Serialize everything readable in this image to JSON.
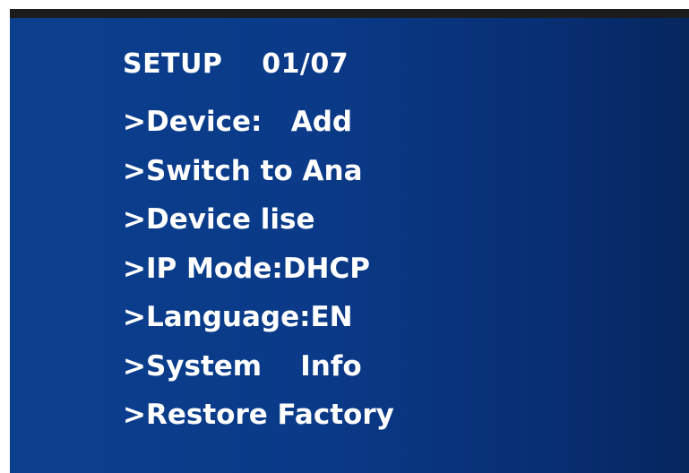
{
  "menu": {
    "title": "SETUP    01/07",
    "items": [
      {
        "label": ">Device:   Add"
      },
      {
        "label": ">Switch to Ana"
      },
      {
        "label": ">Device lise"
      },
      {
        "label": ">IP Mode:DHCP"
      },
      {
        "label": ">Language:EN"
      },
      {
        "label": ">System    Info"
      },
      {
        "label": ">Restore Factory"
      }
    ]
  },
  "colors": {
    "screen_bg": "#0a3a88",
    "text": "#ffffff",
    "top_bar": "#1c1c1c"
  }
}
